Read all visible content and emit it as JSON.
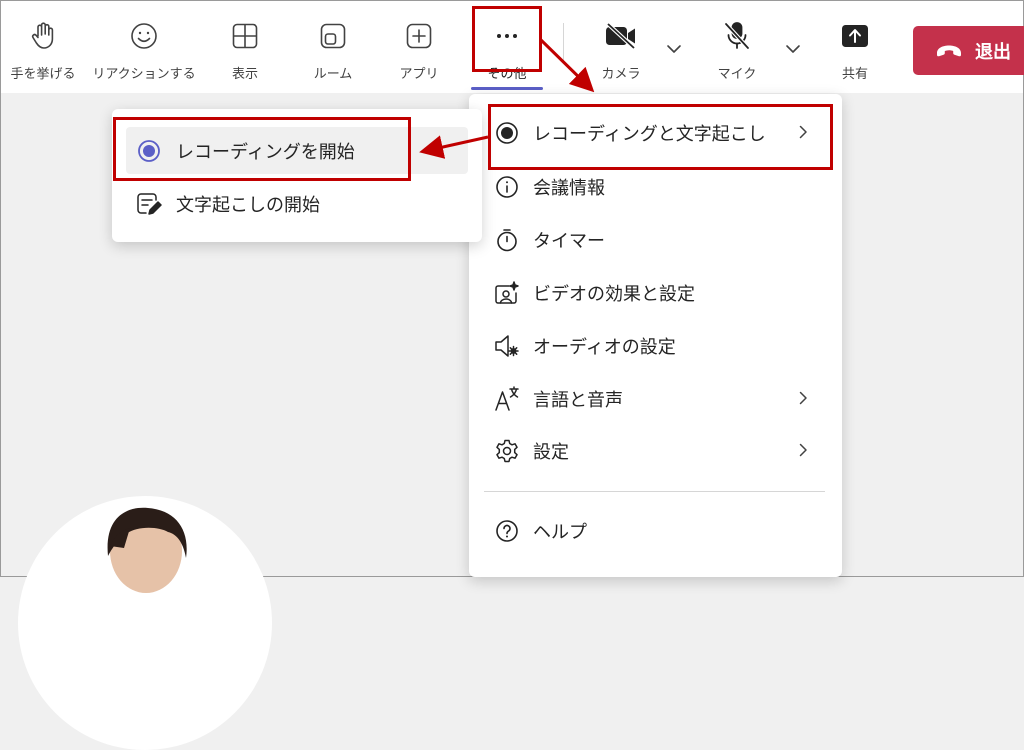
{
  "toolbar": {
    "raise_hand": "手を挙げる",
    "reactions": "リアクションする",
    "view": "表示",
    "rooms": "ルーム",
    "apps": "アプリ",
    "more": "その他",
    "camera": "カメラ",
    "mic": "マイク",
    "share": "共有",
    "leave": "退出"
  },
  "more_menu": {
    "items": [
      {
        "label": "レコーディングと文字起こし",
        "icon": "record-icon",
        "has_submenu": true
      },
      {
        "label": "会議情報",
        "icon": "info-icon",
        "has_submenu": false
      },
      {
        "label": "タイマー",
        "icon": "timer-icon",
        "has_submenu": false
      },
      {
        "label": "ビデオの効果と設定",
        "icon": "video-effects-icon",
        "has_submenu": false
      },
      {
        "label": "オーディオの設定",
        "icon": "audio-settings-icon",
        "has_submenu": false
      },
      {
        "label": "言語と音声",
        "icon": "language-icon",
        "has_submenu": true
      },
      {
        "label": "設定",
        "icon": "gear-icon",
        "has_submenu": true
      },
      {
        "label": "ヘルプ",
        "icon": "help-icon",
        "has_submenu": false
      }
    ]
  },
  "recording_submenu": {
    "items": [
      {
        "label": "レコーディングを開始",
        "icon": "record-start-icon"
      },
      {
        "label": "文字起こしの開始",
        "icon": "transcript-icon"
      }
    ]
  },
  "colors": {
    "accent": "#5b5fc7",
    "leave": "#c4314b",
    "annotation": "#c00000"
  }
}
